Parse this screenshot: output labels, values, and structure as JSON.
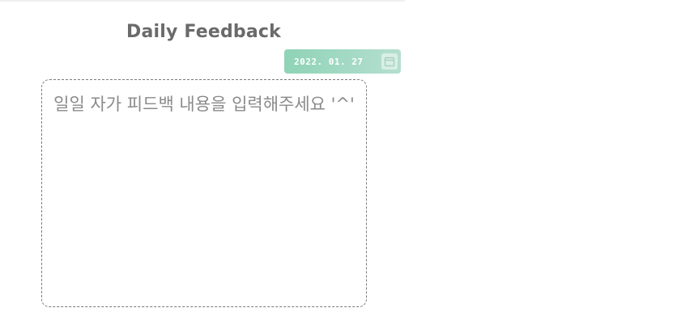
{
  "page": {
    "title": "Daily Feedback"
  },
  "date_picker": {
    "value": "2022. 01. 27",
    "icon": "calendar-icon",
    "colors": {
      "gradient_start": "#8fd3b6",
      "gradient_end": "#b5dfd0"
    }
  },
  "feedback": {
    "placeholder": "일일 자가 피드백 내용을 입력해주세요 '^'",
    "value": ""
  }
}
